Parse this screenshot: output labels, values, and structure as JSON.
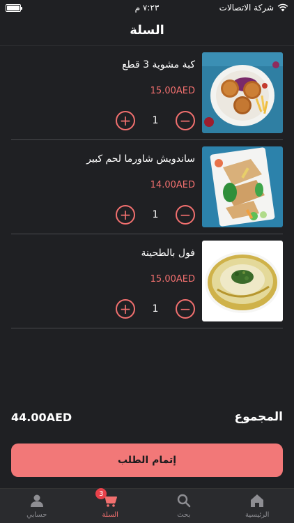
{
  "status_bar": {
    "carrier": "شركة الاتصالات",
    "time": "٧:٢٣ م"
  },
  "header": {
    "title": "السلة"
  },
  "cart": {
    "items": [
      {
        "name": "كبة مشوية 3 قطع",
        "price": "15.00AED",
        "quantity": "1",
        "image_icon": "fried-kibbeh-plate-image"
      },
      {
        "name": "ساندويش شاورما لحم كبير",
        "price": "14.00AED",
        "quantity": "1",
        "image_icon": "shawarma-sandwich-plate-image"
      },
      {
        "name": "فول بالطحينة",
        "price": "15.00AED",
        "quantity": "1",
        "image_icon": "foul-with-tahini-bowl-image"
      }
    ]
  },
  "summary": {
    "total_label": "المجموع",
    "total_value": "44.00AED"
  },
  "checkout": {
    "label": "إتمام الطلب"
  },
  "tabbar": {
    "tabs": [
      {
        "label": "الرئيسية",
        "icon": "home-icon"
      },
      {
        "label": "بحث",
        "icon": "search-icon"
      },
      {
        "label": "السلة",
        "icon": "cart-icon",
        "badge": "3",
        "active": true
      },
      {
        "label": "حسابي",
        "icon": "profile-icon"
      }
    ]
  },
  "colors": {
    "accent": "#f2706f",
    "background": "#1f2023",
    "checkout_button": "#f27878",
    "badge": "#e8414a"
  }
}
